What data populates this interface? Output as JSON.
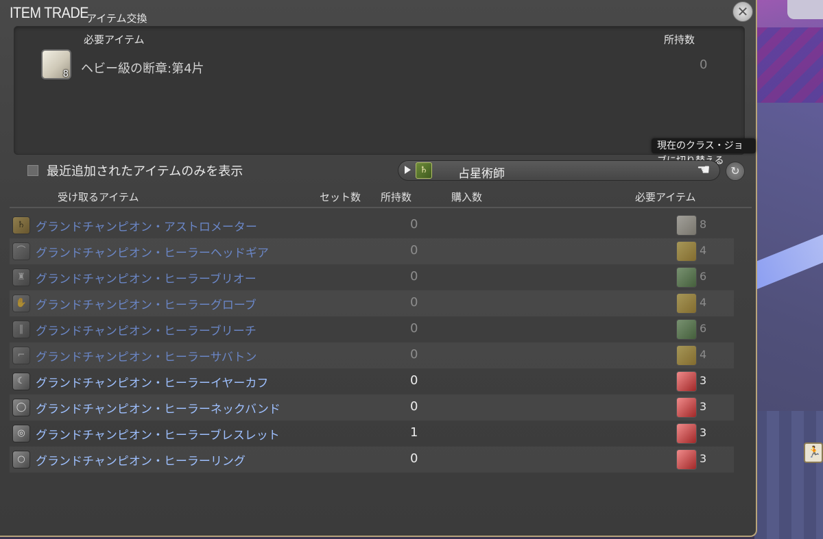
{
  "window": {
    "title": "ITEM TRADE",
    "subtitle": "アイテム交換"
  },
  "required": {
    "header_item": "必要アイテム",
    "header_owned": "所持数",
    "item_name": "ヘビー級の断章:第4片",
    "item_icon_count": "8",
    "owned": "0"
  },
  "tooltip": "現在のクラス・ジョブに切り替える",
  "filter": {
    "checkbox_label": "最近追加されたアイテムのみを表示",
    "checked": false
  },
  "job_select": {
    "icon": "astrologian-job-icon",
    "value": "占星術師"
  },
  "table": {
    "headers": {
      "receive": "受け取るアイテム",
      "sets": "セット数",
      "owned": "所持数",
      "purchase": "購入数",
      "required": "必要アイテム"
    },
    "rows": [
      {
        "icon": "astrometer-icon",
        "name": "グランドチャンピオン・アストロメーター",
        "owned": "0",
        "currency": "white",
        "qty": "8",
        "active": false
      },
      {
        "icon": "headgear-icon",
        "name": "グランドチャンピオン・ヒーラーヘッドギア",
        "owned": "0",
        "currency": "yellow",
        "qty": "4",
        "active": false
      },
      {
        "icon": "body-armor-icon",
        "name": "グランドチャンピオン・ヒーラーブリオー",
        "owned": "0",
        "currency": "green",
        "qty": "6",
        "active": false
      },
      {
        "icon": "gloves-icon",
        "name": "グランドチャンピオン・ヒーラーグローブ",
        "owned": "0",
        "currency": "yellow",
        "qty": "4",
        "active": false
      },
      {
        "icon": "legs-icon",
        "name": "グランドチャンピオン・ヒーラーブリーチ",
        "owned": "0",
        "currency": "green",
        "qty": "6",
        "active": false
      },
      {
        "icon": "boots-icon",
        "name": "グランドチャンピオン・ヒーラーサバトン",
        "owned": "0",
        "currency": "yellow",
        "qty": "4",
        "active": false
      },
      {
        "icon": "earring-icon",
        "name": "グランドチャンピオン・ヒーラーイヤーカフ",
        "owned": "0",
        "currency": "red",
        "qty": "3",
        "active": true
      },
      {
        "icon": "necklace-icon",
        "name": "グランドチャンピオン・ヒーラーネックバンド",
        "owned": "0",
        "currency": "red",
        "qty": "3",
        "active": true
      },
      {
        "icon": "bracelet-icon",
        "name": "グランドチャンピオン・ヒーラーブレスレット",
        "owned": "1",
        "currency": "red",
        "qty": "3",
        "active": true
      },
      {
        "icon": "ring-icon",
        "name": "グランドチャンピオン・ヒーラーリング",
        "owned": "0",
        "currency": "red",
        "qty": "3",
        "active": true
      }
    ]
  }
}
